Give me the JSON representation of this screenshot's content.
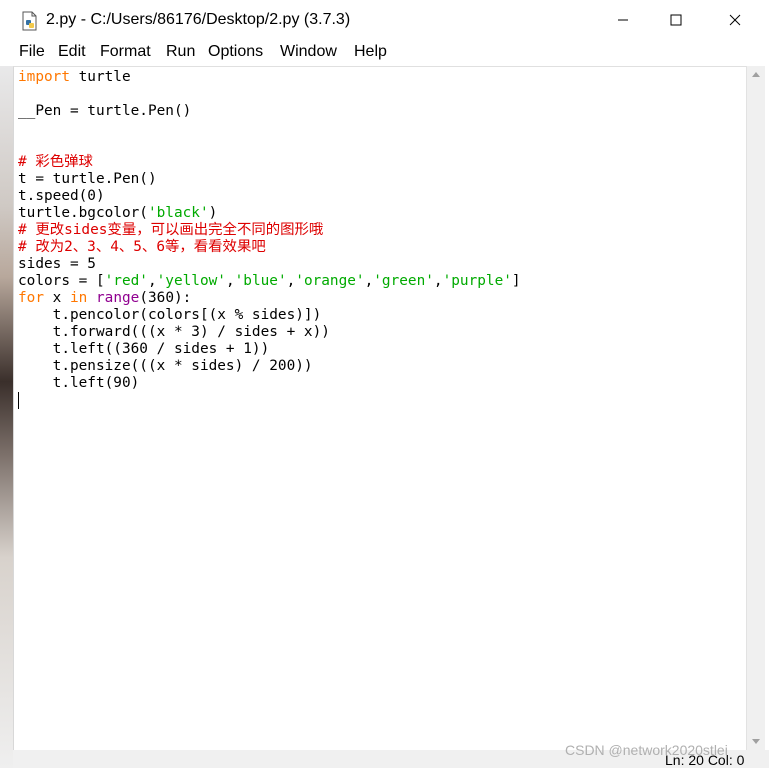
{
  "window": {
    "title": "2.py - C:/Users/86176/Desktop/2.py (3.7.3)",
    "icon": "python-file-icon"
  },
  "menu": {
    "items": [
      "File",
      "Edit",
      "Format",
      "Run",
      "Options",
      "Window",
      "Help"
    ]
  },
  "code_lines": [
    [
      {
        "t": "import",
        "c": "kw"
      },
      {
        "t": " turtle",
        "c": ""
      }
    ],
    [],
    [
      {
        "t": "__Pen = turtle.Pen()",
        "c": ""
      }
    ],
    [],
    [],
    [
      {
        "t": "# 彩色弹球",
        "c": "cm"
      }
    ],
    [
      {
        "t": "t = turtle.Pen()",
        "c": ""
      }
    ],
    [
      {
        "t": "t.speed(0)",
        "c": ""
      }
    ],
    [
      {
        "t": "turtle.bgcolor(",
        "c": ""
      },
      {
        "t": "'black'",
        "c": "st"
      },
      {
        "t": ")",
        "c": ""
      }
    ],
    [
      {
        "t": "# 更改sides变量，可以画出完全不同的图形哦",
        "c": "cm"
      }
    ],
    [
      {
        "t": "# 改为2、3、4、5、6等，看看效果吧",
        "c": "cm"
      }
    ],
    [
      {
        "t": "sides = 5",
        "c": ""
      }
    ],
    [
      {
        "t": "colors = [",
        "c": ""
      },
      {
        "t": "'red'",
        "c": "st"
      },
      {
        "t": ",",
        "c": ""
      },
      {
        "t": "'yellow'",
        "c": "st"
      },
      {
        "t": ",",
        "c": ""
      },
      {
        "t": "'blue'",
        "c": "st"
      },
      {
        "t": ",",
        "c": ""
      },
      {
        "t": "'orange'",
        "c": "st"
      },
      {
        "t": ",",
        "c": ""
      },
      {
        "t": "'green'",
        "c": "st"
      },
      {
        "t": ",",
        "c": ""
      },
      {
        "t": "'purple'",
        "c": "st"
      },
      {
        "t": "]",
        "c": ""
      }
    ],
    [
      {
        "t": "for",
        "c": "kw"
      },
      {
        "t": " x ",
        "c": ""
      },
      {
        "t": "in",
        "c": "kw"
      },
      {
        "t": " ",
        "c": ""
      },
      {
        "t": "range",
        "c": "bi"
      },
      {
        "t": "(360):",
        "c": ""
      }
    ],
    [
      {
        "t": "    t.pencolor(colors[(x % sides)])",
        "c": ""
      }
    ],
    [
      {
        "t": "    t.forward(((x * 3) / sides + x))",
        "c": ""
      }
    ],
    [
      {
        "t": "    t.left((360 / sides + 1))",
        "c": ""
      }
    ],
    [
      {
        "t": "    t.pensize(((x * sides) / 200))",
        "c": ""
      }
    ],
    [
      {
        "t": "    t.left(90)",
        "c": ""
      }
    ],
    []
  ],
  "status": {
    "watermark": "CSDN @network2020stlei",
    "position": "Ln: 20  Col: 0"
  },
  "colors": {
    "keyword": "#ff7700",
    "comment": "#dd0000",
    "string": "#00aa00",
    "builtin": "#900090"
  }
}
